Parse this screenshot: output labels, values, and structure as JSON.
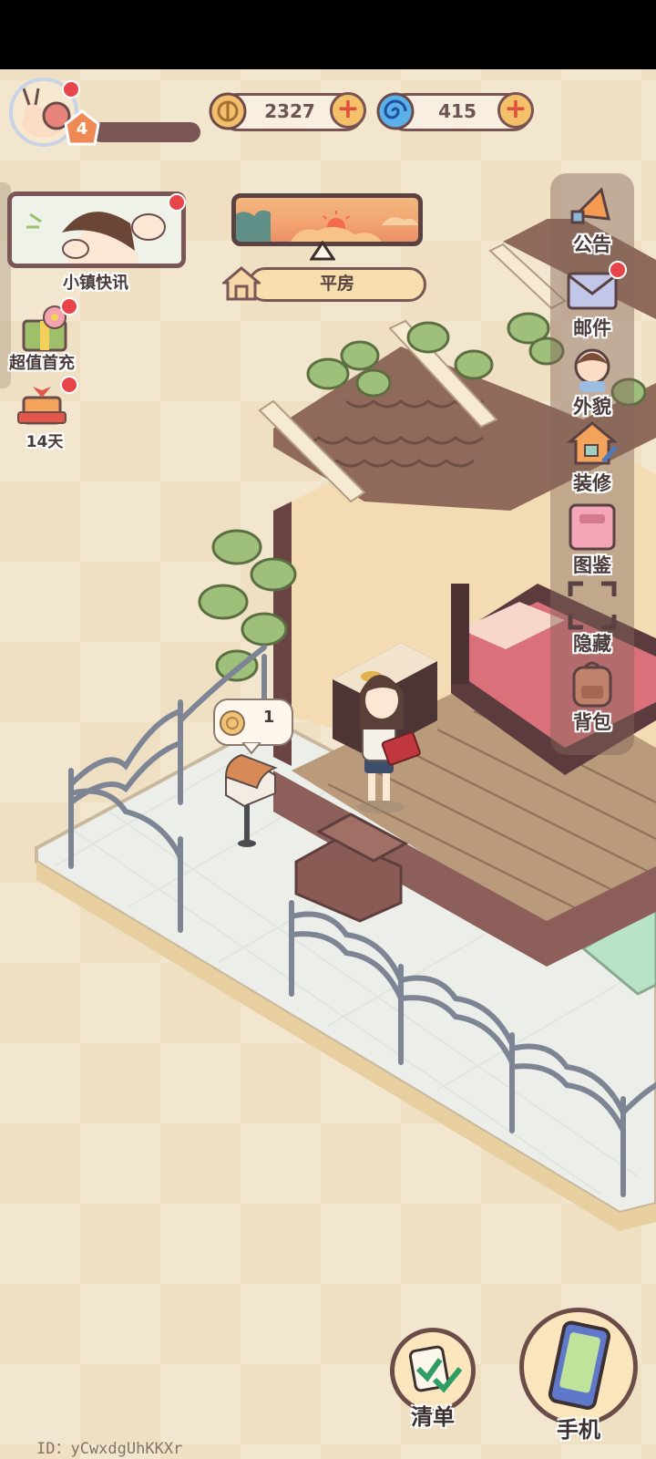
{
  "status_bar": {},
  "player": {
    "level": "4",
    "id_text": "ID：yCwxdgUhKKXr"
  },
  "currencies": {
    "coins": "2327",
    "gems": "415"
  },
  "left_panel": {
    "news_label": "小镇快讯",
    "first_recharge_label": "超值首充",
    "checkin_label": "14天"
  },
  "weather": {
    "house_type": "平房"
  },
  "right_menu": [
    {
      "label": "公告",
      "icon": "megaphone-icon"
    },
    {
      "label": "邮件",
      "icon": "mail-icon"
    },
    {
      "label": "外貌",
      "icon": "character-icon"
    },
    {
      "label": "装修",
      "icon": "renovate-icon"
    },
    {
      "label": "图鉴",
      "icon": "collection-book-icon"
    },
    {
      "label": "隐藏",
      "icon": "hide-icon"
    },
    {
      "label": "背包",
      "icon": "backpack-icon"
    }
  ],
  "mailbox_bubble": {
    "count": "1"
  },
  "bottom": {
    "list_label": "清单",
    "phone_label": "手机"
  },
  "colors": {
    "background": "#efe0c3",
    "frame_brown": "#7a5656",
    "notification_red": "#e8454a",
    "accent_orange": "#f4c06a"
  }
}
